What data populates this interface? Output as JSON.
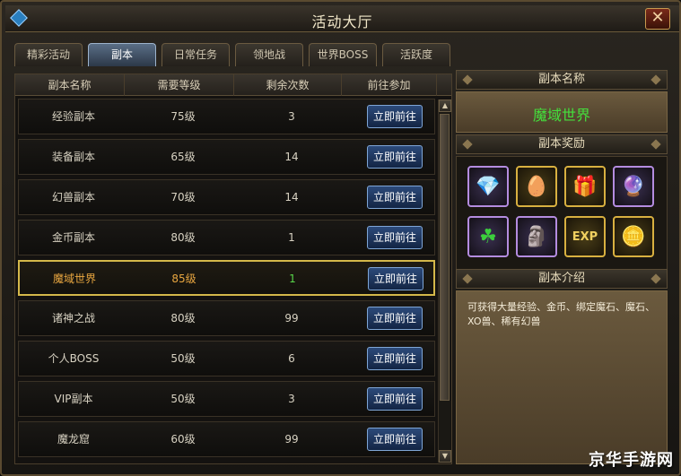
{
  "window": {
    "title": "活动大厅",
    "close_label": "✕"
  },
  "tabs": [
    {
      "label": "精彩活动",
      "active": false
    },
    {
      "label": "副本",
      "active": true
    },
    {
      "label": "日常任务",
      "active": false
    },
    {
      "label": "领地战",
      "active": false
    },
    {
      "label": "世界BOSS",
      "active": false
    },
    {
      "label": "活跃度",
      "active": false
    }
  ],
  "table": {
    "headers": [
      "副本名称",
      "需要等级",
      "剩余次数",
      "前往参加"
    ],
    "button_label": "立即前往",
    "rows": [
      {
        "name": "经验副本",
        "level": "75级",
        "count": "3",
        "selected": false
      },
      {
        "name": "装备副本",
        "level": "65级",
        "count": "14",
        "selected": false
      },
      {
        "name": "幻兽副本",
        "level": "70级",
        "count": "14",
        "selected": false
      },
      {
        "name": "金币副本",
        "level": "80级",
        "count": "1",
        "selected": false
      },
      {
        "name": "魔域世界",
        "level": "85级",
        "count": "1",
        "selected": true
      },
      {
        "name": "诸神之战",
        "level": "80级",
        "count": "99",
        "selected": false
      },
      {
        "name": "个人BOSS",
        "level": "50级",
        "count": "6",
        "selected": false
      },
      {
        "name": "VIP副本",
        "level": "50级",
        "count": "3",
        "selected": false
      },
      {
        "name": "魔龙窟",
        "level": "60级",
        "count": "99",
        "selected": false
      }
    ]
  },
  "side": {
    "name_header": "副本名称",
    "dungeon_name": "魔域世界",
    "reward_header": "副本奖励",
    "rewards": [
      {
        "icon": "diamond-icon",
        "glyph": "💎",
        "frame": "purple"
      },
      {
        "icon": "blue-egg-icon",
        "glyph": "🥚",
        "frame": "gold"
      },
      {
        "icon": "gift-box-icon",
        "glyph": "🎁",
        "frame": "gold"
      },
      {
        "icon": "crystal-icon",
        "glyph": "🔮",
        "frame": "purple"
      },
      {
        "icon": "clover-icon",
        "glyph": "☘",
        "frame": "purple"
      },
      {
        "icon": "statue-icon",
        "glyph": "🗿",
        "frame": "purple"
      },
      {
        "icon": "exp-icon",
        "glyph": "EXP",
        "frame": "gold"
      },
      {
        "icon": "gold-coins-icon",
        "glyph": "🪙",
        "frame": "gold"
      }
    ],
    "intro_header": "副本介绍",
    "intro_text": "可获得大量经验、金币、绑定魔石、魔石、XO兽、稀有幻兽"
  },
  "watermark": "京华手游网"
}
